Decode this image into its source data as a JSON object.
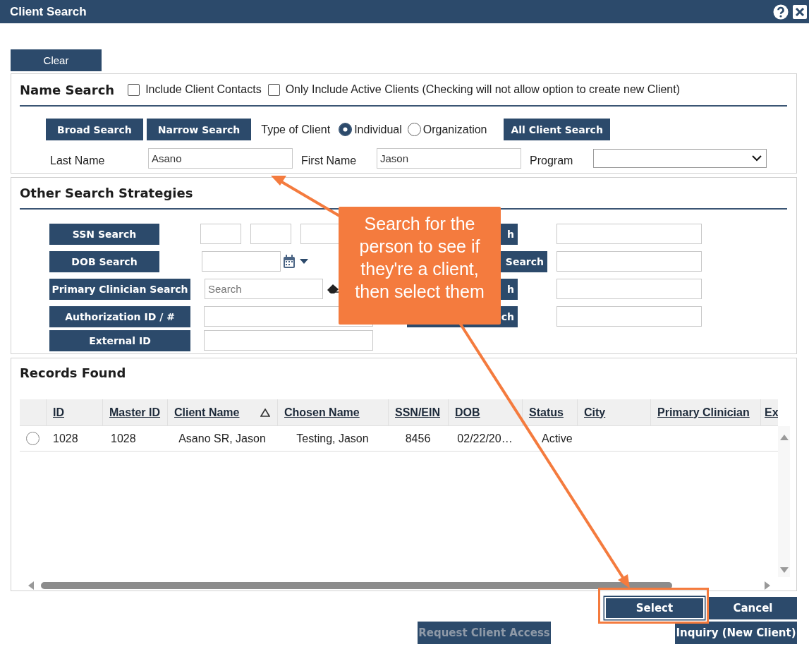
{
  "window": {
    "title": "Client Search"
  },
  "clear_button": "Clear",
  "name_search": {
    "title": "Name Search",
    "options": [
      {
        "label": "Include Client Contacts",
        "checked": false
      },
      {
        "label": "Only Include Active Clients (Checking will not allow option to create new Client)",
        "checked": false
      }
    ],
    "search_buttons": [
      "Broad Search",
      "Narrow Search"
    ],
    "type_label": "Type of Client",
    "client_types": [
      {
        "label": "Individual",
        "selected": true
      },
      {
        "label": "Organization",
        "selected": false
      }
    ],
    "all_button": "All Client Search",
    "fields": [
      {
        "kind": "text",
        "label": "Last Name",
        "value": "Asano"
      },
      {
        "kind": "text",
        "label": "First Name",
        "value": "Jason"
      },
      {
        "kind": "select",
        "label": "Program"
      }
    ]
  },
  "other_search": {
    "title": "Other Search Strategies",
    "rows": [
      {
        "kind": "ssn",
        "button": "SSN Search",
        "right_button": "h"
      },
      {
        "kind": "date",
        "button": "DOB Search",
        "right_button": "Search"
      },
      {
        "kind": "lookup",
        "button": "Primary Clinician Search",
        "placeholder": "Search",
        "right_button": "h"
      },
      {
        "kind": "text",
        "button": "Authorization ID / #",
        "right_button": "ch"
      },
      {
        "kind": "text",
        "button": "External ID"
      }
    ]
  },
  "records": {
    "title": "Records Found",
    "columns": [
      {
        "label": "ID",
        "sorted": false
      },
      {
        "label": "Master ID",
        "sorted": false
      },
      {
        "label": "Client Name",
        "sorted": true
      },
      {
        "label": "Chosen Name",
        "sorted": false
      },
      {
        "label": "SSN/EIN",
        "sorted": false
      },
      {
        "label": "DOB",
        "sorted": false
      },
      {
        "label": "Status",
        "sorted": false
      },
      {
        "label": "City",
        "sorted": false
      },
      {
        "label": "Primary Clinician",
        "sorted": false
      },
      {
        "label": "Ex",
        "sorted": false
      }
    ],
    "rows": [
      {
        "selected": false,
        "cells": [
          "1028",
          "1028",
          "Asano SR, Jason",
          "Testing, Jason",
          "8456",
          "02/22/20…",
          "Active"
        ]
      }
    ]
  },
  "actions": {
    "select": "Select",
    "cancel": "Cancel",
    "request": {
      "label": "Request Client Access",
      "disabled": true
    },
    "inquiry": "Inquiry (New Client)"
  },
  "callout": "Search for the person to see if they're a client, then select them"
}
